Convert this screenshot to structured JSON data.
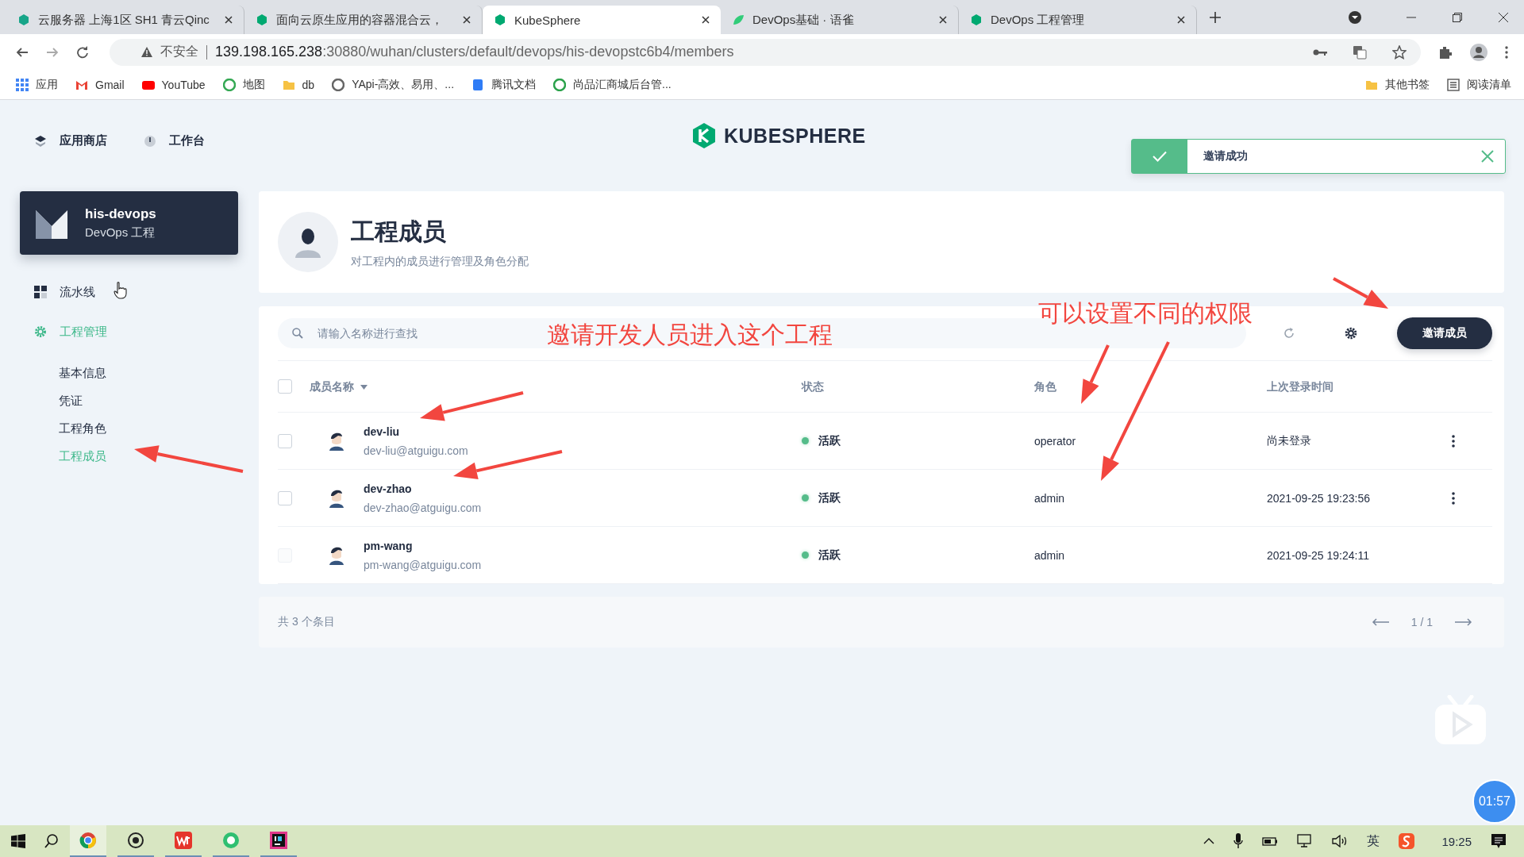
{
  "browser": {
    "tabs": [
      {
        "title": "云服务器 上海1区 SH1 青云Qinc",
        "selected": false
      },
      {
        "title": "面向云原生应用的容器混合云，",
        "selected": false
      },
      {
        "title": "KubeSphere",
        "selected": true
      },
      {
        "title": "DevOps基础 · 语雀",
        "selected": false
      },
      {
        "title": "DevOps 工程管理",
        "selected": false
      }
    ],
    "address": {
      "security": "不安全",
      "host": "139.198.165.238",
      "path": ":30880/wuhan/clusters/default/devops/his-devopstc6b4/members"
    },
    "bookmarks": [
      "应用",
      "Gmail",
      "YouTube",
      "地图",
      "db",
      "YApi-高效、易用、...",
      "腾讯文档",
      "尚品汇商城后台管..."
    ],
    "bookmarks_right": [
      "其他书签",
      "阅读清单"
    ]
  },
  "top_nav": [
    "应用商店",
    "工作台"
  ],
  "logo": "KUBESPHERE",
  "toast": {
    "message": "邀请成功"
  },
  "project": {
    "name": "his-devops",
    "type": "DevOps 工程"
  },
  "sidebar": [
    {
      "label": "流水线",
      "kind": "item",
      "selected": false
    },
    {
      "label": "工程管理",
      "kind": "group",
      "selected": true,
      "children": [
        {
          "label": "基本信息",
          "selected": false
        },
        {
          "label": "凭证",
          "selected": false
        },
        {
          "label": "工程角色",
          "selected": false
        },
        {
          "label": "工程成员",
          "selected": true
        }
      ]
    }
  ],
  "header": {
    "title": "工程成员",
    "subtitle": "对工程内的成员进行管理及角色分配"
  },
  "search": {
    "placeholder": "请输入名称进行查找"
  },
  "invite_button": "邀请成员",
  "table": {
    "columns": [
      "成员名称",
      "状态",
      "角色",
      "上次登录时间"
    ],
    "all_checked": false,
    "rows": [
      {
        "name": "dev-liu",
        "email": "dev-liu@atguigu.com",
        "status": "活跃",
        "role": "operator",
        "last_login": "尚未登录",
        "checked": false,
        "disabled": false,
        "has_menu": true
      },
      {
        "name": "dev-zhao",
        "email": "dev-zhao@atguigu.com",
        "status": "活跃",
        "role": "admin",
        "last_login": "2021-09-25 19:23:56",
        "checked": false,
        "disabled": false,
        "has_menu": true
      },
      {
        "name": "pm-wang",
        "email": "pm-wang@atguigu.com",
        "status": "活跃",
        "role": "admin",
        "last_login": "2021-09-25 19:24:11",
        "checked": false,
        "disabled": true,
        "has_menu": false
      }
    ]
  },
  "footer": {
    "total": "共 3 个条目",
    "page": "1 / 1"
  },
  "annotations": [
    "邀请开发人员进入这个工程",
    "可以设置不同的权限"
  ],
  "timer": "01:57",
  "taskbar": {
    "ime": "英",
    "time": "19:25"
  }
}
